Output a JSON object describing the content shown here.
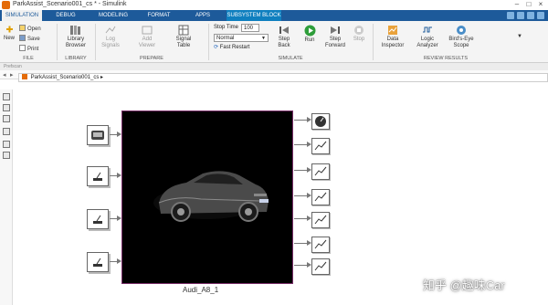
{
  "window": {
    "title": "ParkAssist_Scenario001_cs * - Simulink"
  },
  "tabs": [
    "SIMULATION",
    "DEBUG",
    "MODELING",
    "FORMAT",
    "APPS",
    "SUBSYSTEM BLOCK"
  ],
  "ribbon": {
    "file": {
      "new": "New",
      "open": "Open",
      "save": "Save",
      "print": "Print",
      "group": "FILE"
    },
    "library": {
      "browser": "Library Browser",
      "group": "LIBRARY"
    },
    "prepare": {
      "log_signals": "Log Signals",
      "add_viewer": "Add Viewer",
      "signal_table": "Signal Table",
      "group": "PREPARE"
    },
    "simulate": {
      "stop_time_label": "Stop Time",
      "stop_time_value": "100",
      "mode": "Normal",
      "fast_restart": "Fast Restart",
      "step_back": "Step Back",
      "run": "Run",
      "step_forward": "Step Forward",
      "stop": "Stop",
      "group": "SIMULATE"
    },
    "review": {
      "data_inspector": "Data Inspector",
      "logic_analyzer": "Logic Analyzer",
      "birds_eye": "Bird's-Eye Scope",
      "group": "REVIEW RESULTS"
    }
  },
  "strip_text": "Prefscan",
  "breadcrumb": "ParkAssist_Scenario001_cs",
  "model": {
    "subsystem_name": "Audi_A8_1"
  },
  "watermark": "知乎 @趣味Car",
  "colors": {
    "tabbar": "#1d5a9a",
    "subsystem_border": "#7a2f6a",
    "run_green": "#2e9d3a"
  }
}
